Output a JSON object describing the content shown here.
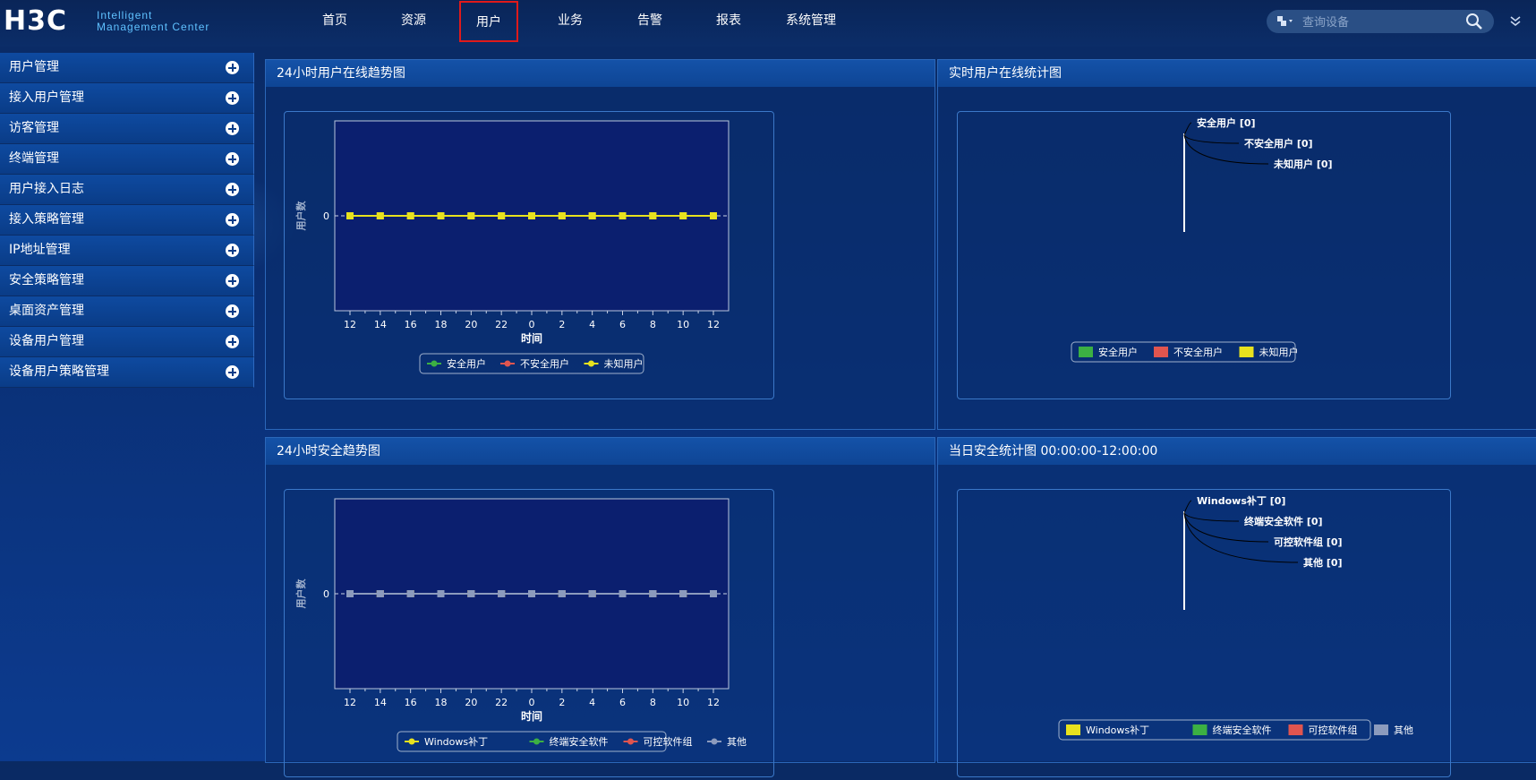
{
  "header": {
    "logo_main": "H3C",
    "logo_sub_1": "Intelligent",
    "logo_sub_2": "Management Center",
    "nav": [
      "首页",
      "资源",
      "用户",
      "业务",
      "告警",
      "报表",
      "系统管理"
    ],
    "active_nav": "用户",
    "search_placeholder": "查询设备"
  },
  "sidebar": {
    "items": [
      "用户管理",
      "接入用户管理",
      "访客管理",
      "终端管理",
      "用户接入日志",
      "接入策略管理",
      "IP地址管理",
      "安全策略管理",
      "桌面资产管理",
      "设备用户管理",
      "设备用户策略管理"
    ]
  },
  "panels": {
    "p1_title": "24小时用户在线趋势图",
    "p2_title": "实时用户在线统计图",
    "p3_title": "24小时安全趋势图",
    "p4_title": "当日安全统计图 00:00:00-12:00:00"
  },
  "chart_data": [
    {
      "type": "line",
      "title": "",
      "xlabel": "时间",
      "ylabel": "用户数",
      "categories": [
        "12",
        "14",
        "16",
        "18",
        "20",
        "22",
        "0",
        "2",
        "4",
        "6",
        "8",
        "10",
        "12"
      ],
      "y_ticks": [
        "0"
      ],
      "series": [
        {
          "name": "安全用户",
          "color": "#3cb043",
          "values": [
            0,
            0,
            0,
            0,
            0,
            0,
            0,
            0,
            0,
            0,
            0,
            0,
            0
          ]
        },
        {
          "name": "不安全用户",
          "color": "#e0554f",
          "values": [
            0,
            0,
            0,
            0,
            0,
            0,
            0,
            0,
            0,
            0,
            0,
            0,
            0
          ]
        },
        {
          "name": "未知用户",
          "color": "#e8e21e",
          "values": [
            0,
            0,
            0,
            0,
            0,
            0,
            0,
            0,
            0,
            0,
            0,
            0,
            0
          ]
        }
      ],
      "legend": "bottom"
    },
    {
      "type": "pie",
      "slices": [
        {
          "label": "安全用户 [0]",
          "name": "安全用户",
          "value": 0,
          "color": "#3cb043"
        },
        {
          "label": "不安全用户 [0]",
          "name": "不安全用户",
          "value": 0,
          "color": "#e0554f"
        },
        {
          "label": "未知用户 [0]",
          "name": "未知用户",
          "value": 0,
          "color": "#e8e21e"
        }
      ],
      "legend": "bottom"
    },
    {
      "type": "line",
      "title": "",
      "xlabel": "时间",
      "ylabel": "用户数",
      "categories": [
        "12",
        "14",
        "16",
        "18",
        "20",
        "22",
        "0",
        "2",
        "4",
        "6",
        "8",
        "10",
        "12"
      ],
      "y_ticks": [
        "0"
      ],
      "series": [
        {
          "name": "Windows补丁",
          "color": "#e8e21e",
          "values": [
            0,
            0,
            0,
            0,
            0,
            0,
            0,
            0,
            0,
            0,
            0,
            0,
            0
          ]
        },
        {
          "name": "终端安全软件",
          "color": "#3cb043",
          "values": [
            0,
            0,
            0,
            0,
            0,
            0,
            0,
            0,
            0,
            0,
            0,
            0,
            0
          ]
        },
        {
          "name": "可控软件组",
          "color": "#e0554f",
          "values": [
            0,
            0,
            0,
            0,
            0,
            0,
            0,
            0,
            0,
            0,
            0,
            0,
            0
          ]
        },
        {
          "name": "其他",
          "color": "#8c9bbd",
          "values": [
            0,
            0,
            0,
            0,
            0,
            0,
            0,
            0,
            0,
            0,
            0,
            0,
            0
          ]
        }
      ],
      "legend": "bottom"
    },
    {
      "type": "pie",
      "slices": [
        {
          "label": "Windows补丁 [0]",
          "name": "Windows补丁",
          "value": 0,
          "color": "#e8e21e"
        },
        {
          "label": "终端安全软件 [0]",
          "name": "终端安全软件",
          "value": 0,
          "color": "#3cb043"
        },
        {
          "label": "可控软件组 [0]",
          "name": "可控软件组",
          "value": 0,
          "color": "#e0554f"
        },
        {
          "label": "其他 [0]",
          "name": "其他",
          "value": 0,
          "color": "#8c9bbd"
        }
      ],
      "legend": "bottom"
    }
  ]
}
